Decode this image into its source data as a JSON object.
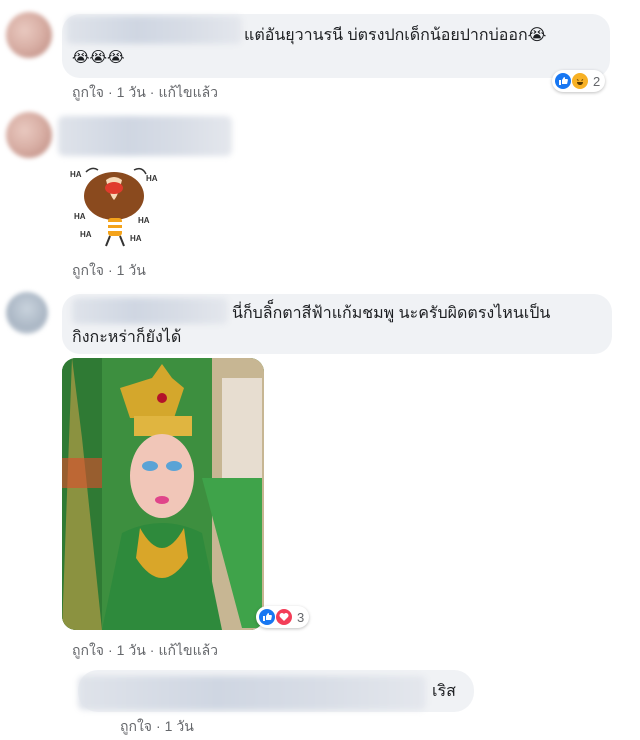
{
  "comments": [
    {
      "text_line1": "แต่อันยุวานรนี บ่ตรงปกเด็กน้อยปากบ่ออก😭",
      "text_line2": "😭😭😭",
      "meta": {
        "like": "ถูกใจ",
        "age": "1 วัน",
        "edited": "แก้ไขแล้ว"
      },
      "reaction_count": "2"
    },
    {
      "sticker_words": [
        "HA",
        "HA",
        "HA",
        "HA",
        "HA",
        "HA"
      ],
      "meta": {
        "like": "ถูกใจ",
        "age": "1 วัน"
      }
    },
    {
      "text_line1": "นี่ก็บลิ็กตาสีฟ้าแก้มชมพู นะครับผิดตรงไหนเป็น",
      "text_line2": "กิงกะหร่าก็ยังได้",
      "meta": {
        "like": "ถูกใจ",
        "age": "1 วัน",
        "edited": "แก้ไขแล้ว"
      },
      "reaction_count": "3"
    },
    {
      "text_tail": "เริส",
      "meta": {
        "like": "ถูกใจ",
        "age": "1 วัน"
      }
    }
  ],
  "colors": {
    "bubble": "#f0f2f5",
    "meta": "#65676b",
    "like": "#1877f2",
    "love": "#f33e58",
    "haha": "#f7b125"
  },
  "icons": [
    "like-reaction-icon",
    "haha-reaction-icon",
    "love-reaction-icon",
    "crying-emoji-icon"
  ]
}
